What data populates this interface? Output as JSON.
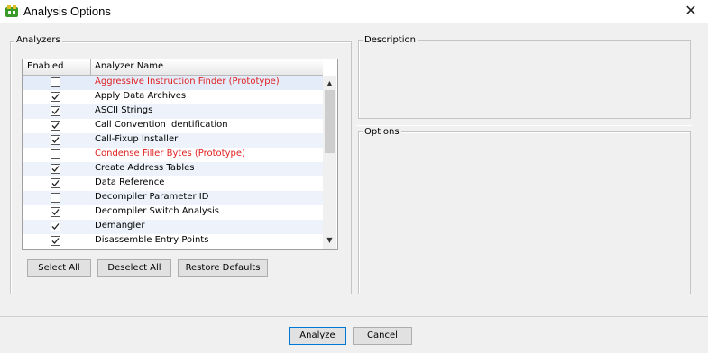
{
  "window": {
    "title": "Analysis Options",
    "icon": "dragon-app-icon",
    "close_label": "✕"
  },
  "analyzers": {
    "group_title": "Analyzers",
    "columns": [
      "Enabled",
      "Analyzer Name"
    ],
    "rows": [
      {
        "name": "Aggressive Instruction Finder (Prototype)",
        "enabled": false,
        "prototype": true
      },
      {
        "name": "Apply Data Archives",
        "enabled": true,
        "prototype": false
      },
      {
        "name": "ASCII Strings",
        "enabled": true,
        "prototype": false
      },
      {
        "name": "Call Convention Identification",
        "enabled": true,
        "prototype": false
      },
      {
        "name": "Call-Fixup Installer",
        "enabled": true,
        "prototype": false
      },
      {
        "name": "Condense Filler Bytes (Prototype)",
        "enabled": false,
        "prototype": true
      },
      {
        "name": "Create Address Tables",
        "enabled": true,
        "prototype": false
      },
      {
        "name": "Data Reference",
        "enabled": true,
        "prototype": false
      },
      {
        "name": "Decompiler Parameter ID",
        "enabled": false,
        "prototype": false
      },
      {
        "name": "Decompiler Switch Analysis",
        "enabled": true,
        "prototype": false
      },
      {
        "name": "Demangler",
        "enabled": true,
        "prototype": false
      },
      {
        "name": "Disassemble Entry Points",
        "enabled": true,
        "prototype": false
      }
    ],
    "buttons": {
      "select_all": "Select All",
      "deselect_all": "Deselect All",
      "restore_defaults": "Restore Defaults"
    }
  },
  "description": {
    "group_title": "Description"
  },
  "options": {
    "group_title": "Options"
  },
  "footer": {
    "analyze": "Analyze",
    "cancel": "Cancel"
  },
  "colors": {
    "prototype_text": "#e02020",
    "default_button_border": "#0078d7"
  }
}
